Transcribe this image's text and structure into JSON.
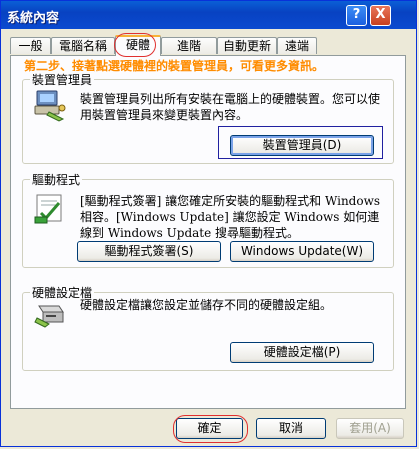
{
  "window": {
    "title": "系統內容"
  },
  "titlebar_buttons": {
    "help": "?",
    "close": "X"
  },
  "tabs": [
    {
      "label": "一般"
    },
    {
      "label": "電腦名稱"
    },
    {
      "label": "硬體"
    },
    {
      "label": "進階"
    },
    {
      "label": "自動更新"
    },
    {
      "label": "遠端"
    }
  ],
  "instruction": "第二步、接著點選硬體裡的裝置管理員，可看更多資訊。",
  "device_manager": {
    "group_label": "裝置管理員",
    "description": "裝置管理員列出所有安裝在電腦上的硬體裝置。您可以使用裝置管理員來變更裝置內容。",
    "button": "裝置管理員(D)"
  },
  "drivers": {
    "group_label": "驅動程式",
    "description": "[驅動程式簽署] 讓您確定所安裝的驅動程式和 Windows 相容。[Windows Update] 讓您設定 Windows 如何連線到 Windows Update 搜尋驅動程式。",
    "signing_button": "驅動程式簽署(S)",
    "update_button": "Windows Update(W)"
  },
  "hardware_profiles": {
    "group_label": "硬體設定檔",
    "description": "硬體設定檔讓您設定並儲存不同的硬體設定組。",
    "button": "硬體設定檔(P)"
  },
  "footer": {
    "ok": "確定",
    "cancel": "取消",
    "apply": "套用(A)"
  }
}
